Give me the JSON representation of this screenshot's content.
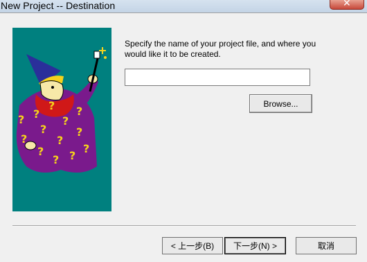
{
  "window": {
    "title": "New Project -- Destination",
    "close_glyph": "✕"
  },
  "wizard": {
    "prompt": "Specify the name of your project file, and where you would like it to be created.",
    "project_name_value": "",
    "browse_label": "Browse..."
  },
  "footer": {
    "back_label": "< 上一步(B)",
    "next_label": "下一步(N) >",
    "cancel_label": "取消"
  },
  "colors": {
    "wizard_background": "#00807f",
    "robe": "#7a1a8c",
    "hat": "#2a2f9a",
    "beard": "#d01818"
  },
  "icons": {
    "wizard_image": "wizard-illustration",
    "close": "close-icon"
  }
}
